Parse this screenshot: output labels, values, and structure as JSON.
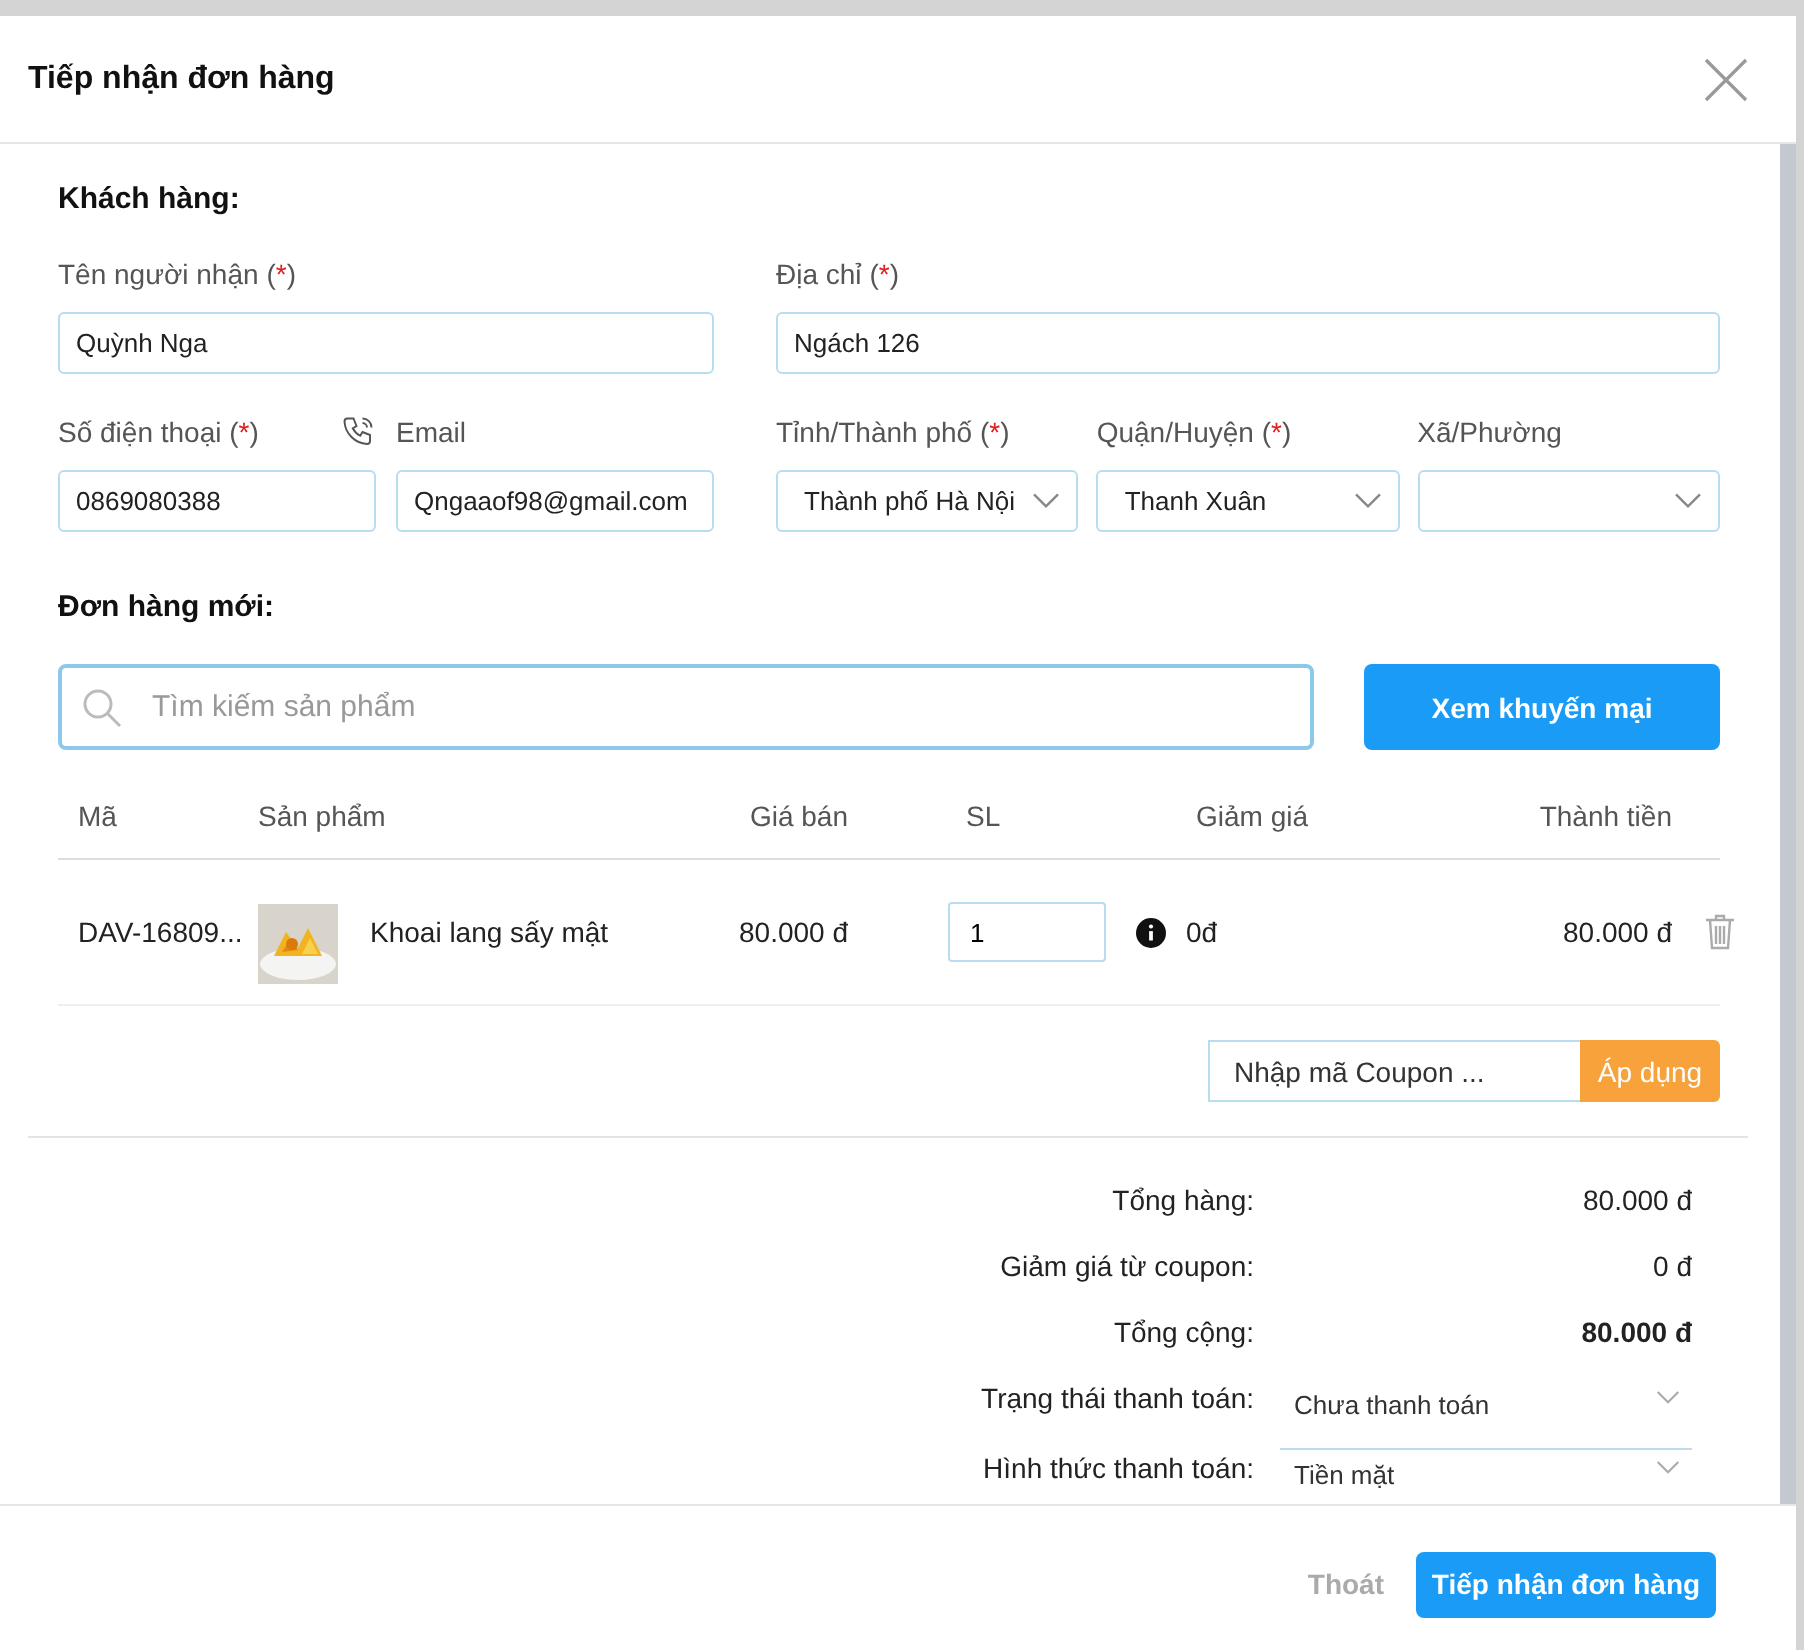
{
  "dialog": {
    "title": "Tiếp nhận đơn hàng"
  },
  "customer": {
    "heading": "Khách hàng:",
    "row_1": [
      {
        "label": "Tên người nhận",
        "required": "(*)",
        "value": "Quỳnh Nga",
        "kind": "text",
        "phone_icon": false
      },
      {
        "label": "Địa chỉ",
        "required": "(*)",
        "value": "Ngách 126",
        "kind": "text",
        "phone_icon": false
      }
    ],
    "row_2_left": [
      {
        "label": "Số điện thoại",
        "required": "(*)",
        "value": "0869080388",
        "kind": "text",
        "phone_icon": true
      },
      {
        "label": "Email",
        "value": "Qngaaof98@gmail.com",
        "kind": "text",
        "phone_icon": false
      }
    ],
    "row_2_right": [
      {
        "label": "Tỉnh/Thành phố",
        "required": "(*)",
        "value": "Thành phố Hà Nội",
        "kind": "select",
        "phone_icon": false
      },
      {
        "label": "Quận/Huyện",
        "required": "(*)",
        "value": "Thanh Xuân",
        "kind": "select",
        "phone_icon": false
      },
      {
        "label": "Xã/Phường",
        "kind": "select",
        "phone_icon": false
      }
    ]
  },
  "order": {
    "heading": "Đơn hàng mới:",
    "search": {
      "placeholder": "Tìm kiếm sản phẩm"
    },
    "promo_button": "Xem khuyến mại",
    "columns": [
      "Mã",
      "Sản phẩm",
      "Giá bán",
      "SL",
      "Giảm giá",
      "Thành tiền"
    ],
    "rows": [
      {
        "code": "DAV-16809...",
        "product": "Khoai lang sấy mật",
        "price": "80.000 đ",
        "qty": "1",
        "discount": "0đ",
        "total": "80.000 đ"
      }
    ],
    "coupon": {
      "placeholder": "Nhập mã Coupon ...",
      "button": "Áp dụng"
    }
  },
  "summary": [
    {
      "label": "Tổng hàng:",
      "value": "80.000 đ",
      "kind": "text",
      "bold": false
    },
    {
      "label": "Giảm giá từ coupon:",
      "value": "0 đ",
      "kind": "text",
      "bold": false
    },
    {
      "label": "Tổng cộng:",
      "value": "80.000 đ",
      "kind": "text",
      "bold": true
    },
    {
      "label": "Trạng thái thanh toán:",
      "value": "Chưa thanh toán",
      "kind": "select"
    },
    {
      "label": "Hình thức thanh toán:",
      "value": "Tiền mặt",
      "kind": "select"
    }
  ],
  "footer": {
    "cancel": "Thoát",
    "submit": "Tiếp nhận đơn hàng"
  }
}
